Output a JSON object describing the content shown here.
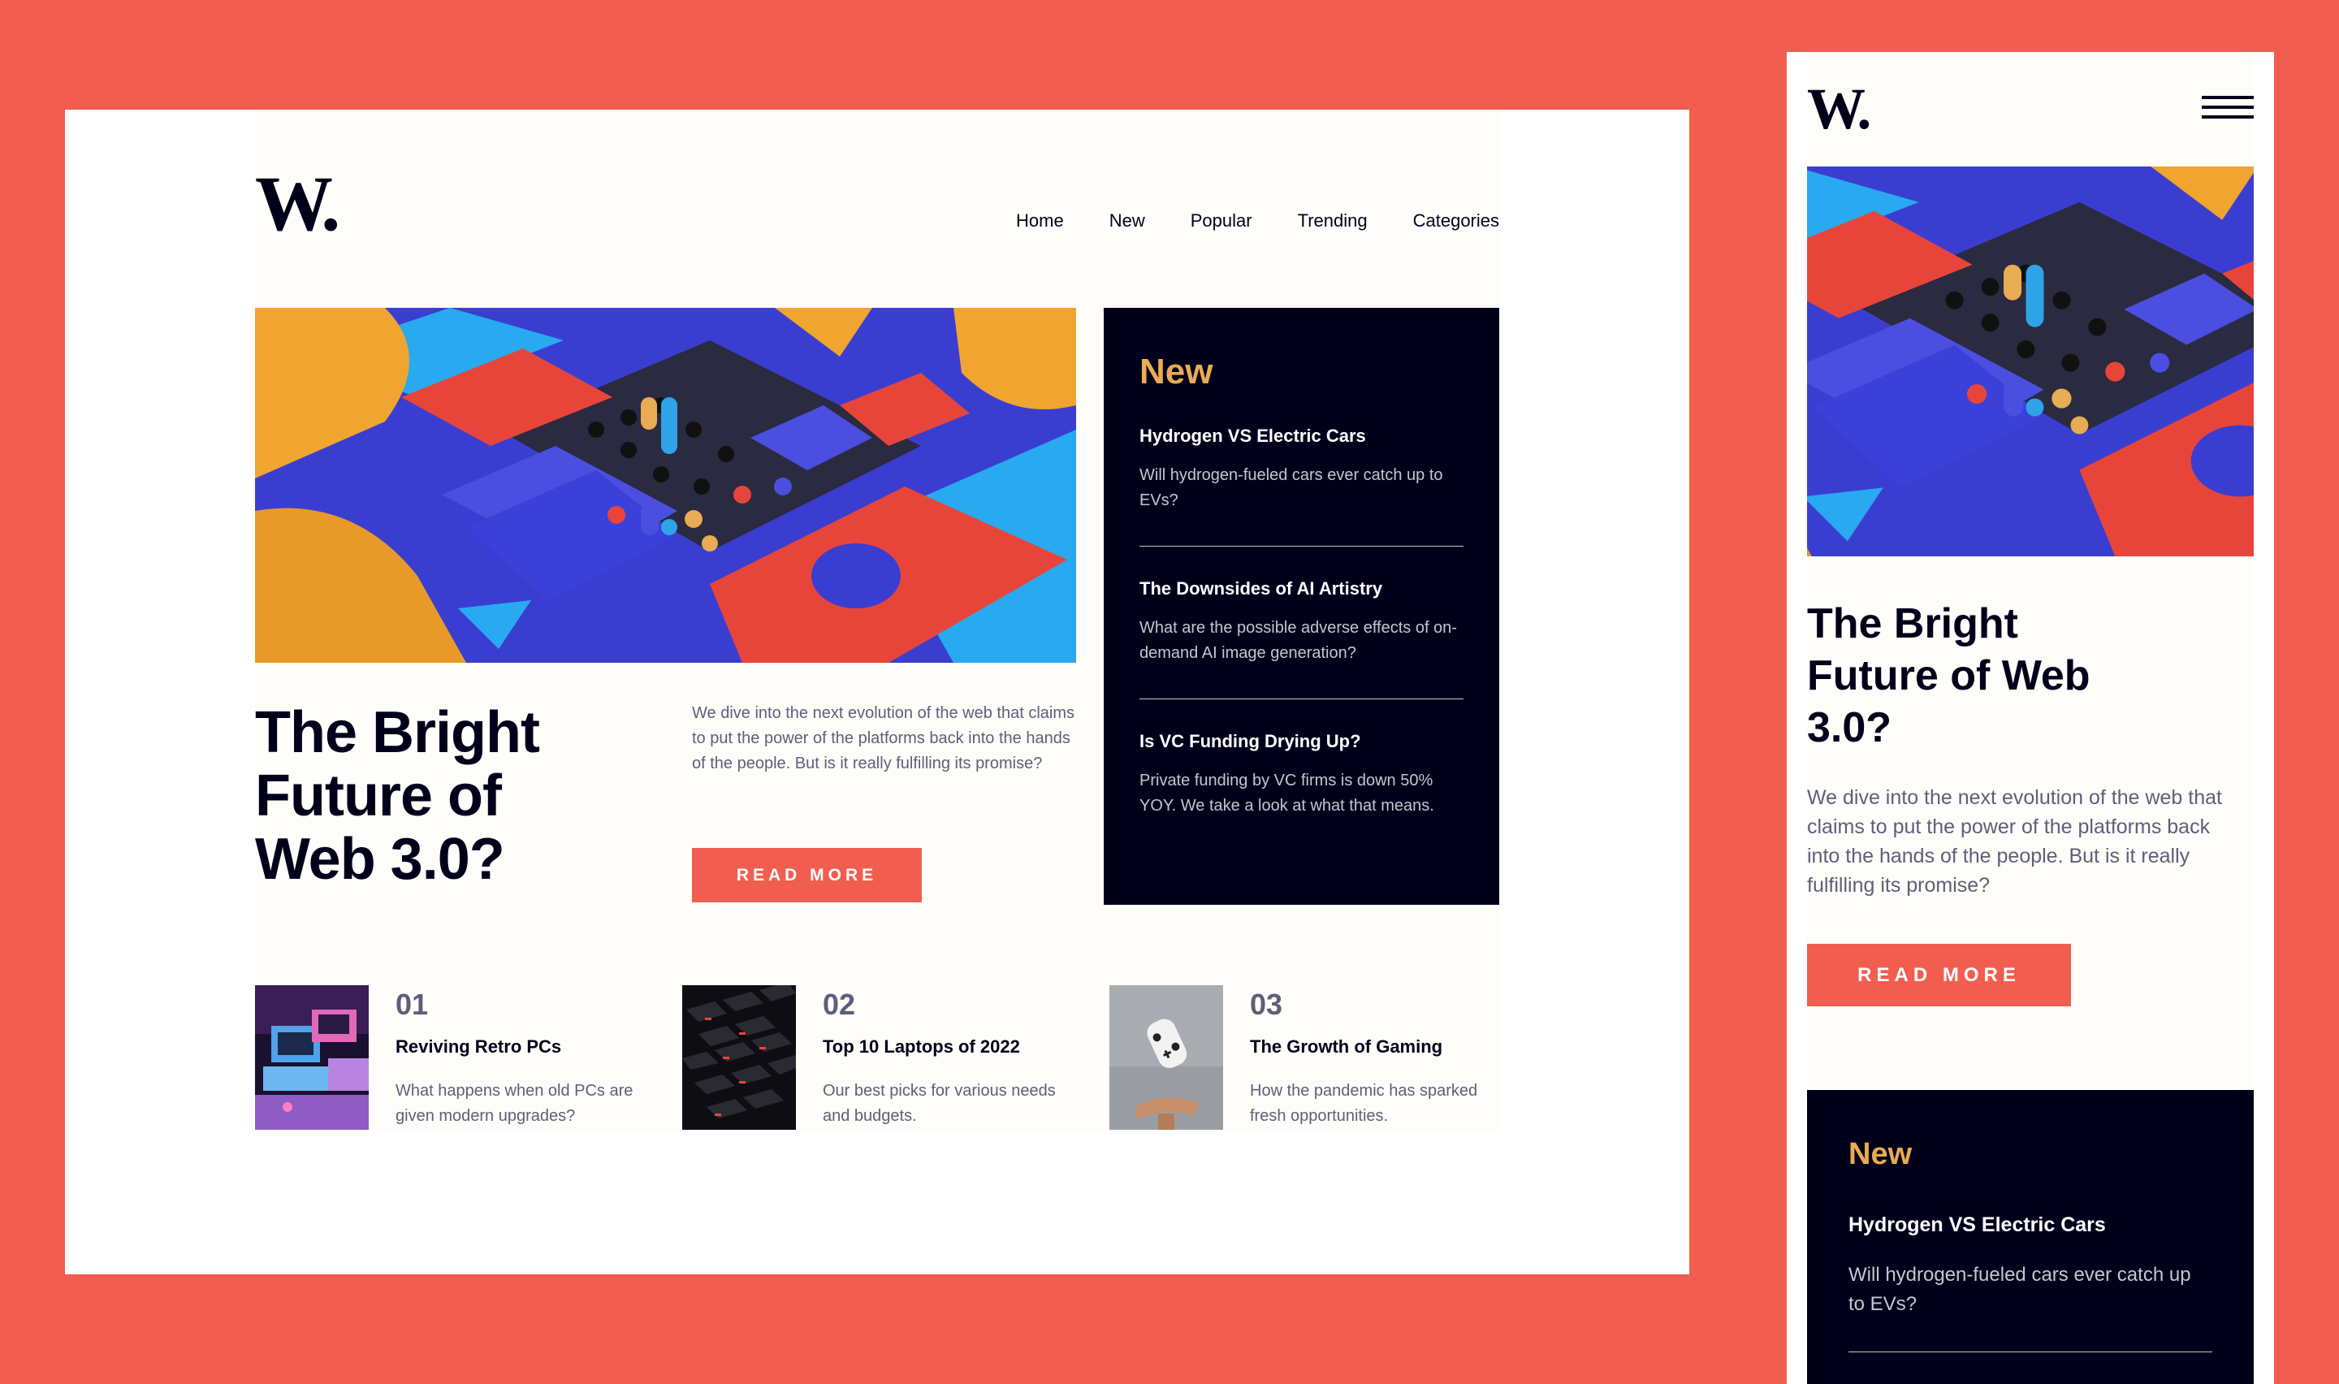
{
  "brand": {
    "logo": "W."
  },
  "nav": [
    "Home",
    "New",
    "Popular",
    "Trending",
    "Categories"
  ],
  "hero": {
    "title": "The Bright Future of Web 3.0?",
    "description": "We dive into the next evolution of the web that claims to put the power of the platforms back into the hands of the people. But is it really fulfilling its promise?",
    "button": "READ MORE"
  },
  "new_section": {
    "heading": "New",
    "items": [
      {
        "title": "Hydrogen VS Electric Cars",
        "text": "Will hydrogen-fueled cars ever catch up to EVs?"
      },
      {
        "title": "The Downsides of AI Artistry",
        "text": "What are the possible adverse effects of on-demand AI image generation?"
      },
      {
        "title": "Is VC Funding Drying Up?",
        "text": "Private funding by VC firms is down 50% YOY. We take a look at what that means."
      }
    ]
  },
  "articles": [
    {
      "number": "01",
      "title": "Reviving Retro PCs",
      "text": "What happens when old PCs are given modern upgrades?",
      "image": "retro-pc-image"
    },
    {
      "number": "02",
      "title": "Top 10 Laptops of 2022",
      "text": "Our best picks for various needs and budgets.",
      "image": "laptop-keyboard-image"
    },
    {
      "number": "03",
      "title": "The Growth of Gaming",
      "text": "How the pandemic has sparked fresh opportunities.",
      "image": "game-controller-image"
    }
  ],
  "icons": {
    "menu": "hamburger-menu-icon"
  },
  "colors": {
    "background": "#F15E50",
    "accent": "#F15E50",
    "dark": "#00001A",
    "new_heading": "#E9AB53",
    "muted_text": "#5D5F79",
    "page": "#FFFDF9"
  }
}
